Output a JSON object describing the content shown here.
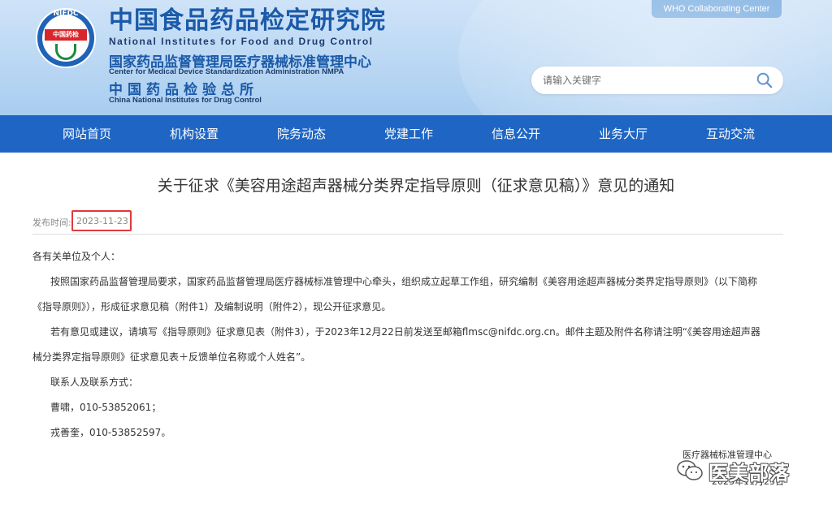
{
  "header": {
    "logo_top": "NIFDC",
    "logo_band": "中国药检",
    "name_cn": "中国食品药品检定研究院",
    "name_en": "National Institutes for Food and Drug Control",
    "center_cn": "国家药品监督管理局医疗器械标准管理中心",
    "center_en": "Center for Medical Device Standardization Administration NMPA",
    "inst_cn": "中国药品检验总所",
    "inst_en": "China National Institutes for Drug Control",
    "who_label": "WHO Collaborating Center"
  },
  "search": {
    "placeholder": "请输入关键字"
  },
  "nav": {
    "items": [
      "网站首页",
      "机构设置",
      "院务动态",
      "党建工作",
      "信息公开",
      "业务大厅",
      "互动交流"
    ]
  },
  "article": {
    "title": "关于征求《美容用途超声器械分类界定指导原则（征求意见稿）》意见的通知",
    "date_label": "发布时间:",
    "date": "2023-11-23",
    "greeting": "各有关单位及个人：",
    "para1_line1": "按照国家药品监督管理局要求，国家药品监督管理局医疗器械标准管理中心牵头，组织成立起草工作组，研究编制《美容用途超声器械分类界定指导原则》（以下简称",
    "para1_line2": "《指导原则》），形成征求意见稿（附件1）及编制说明（附件2），现公开征求意见。",
    "para2_line1": "若有意见或建议，请填写《指导原则》征求意见表（附件3），于2023年12月22日前发送至邮箱flmsc@nifdc.org.cn。邮件主题及附件名称请注明“《美容用途超声器",
    "para2_line2": "械分类界定指导原则》征求意见表＋反馈单位名称或个人姓名”。",
    "contact_label": "联系人及联系方式：",
    "contact1": "曹啸，010-53852061；",
    "contact2": "戎善奎，010-53852597。",
    "signature_org": "医疗器械标准管理中心",
    "signature_date": "2023年11月23日"
  },
  "watermark": {
    "text": "医美部落"
  }
}
